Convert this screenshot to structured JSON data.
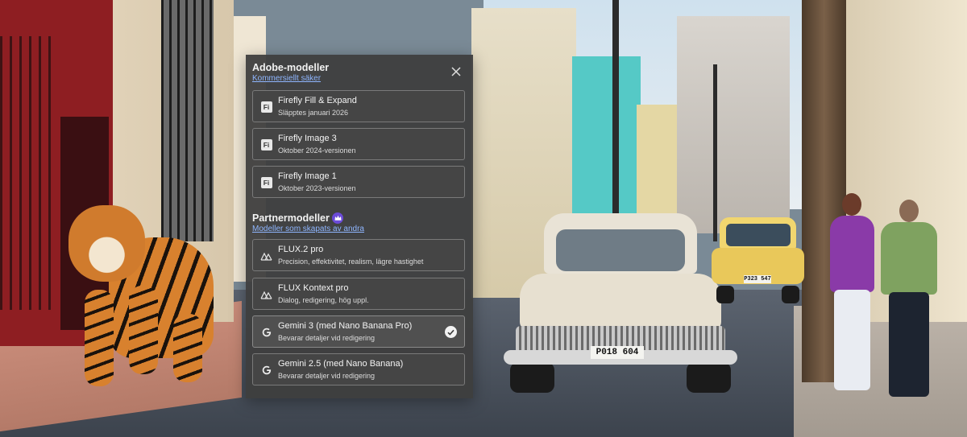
{
  "background": {
    "car1_plate": "P018 604",
    "car2_plate": "P323 547"
  },
  "panel": {
    "adobe_section": {
      "title": "Adobe-modeller",
      "subtitle": "Kommersiellt säker"
    },
    "partner_section": {
      "title": "Partnermodeller",
      "subtitle": "Modeller som skapats av andra"
    },
    "icon_fi_text": "Fi",
    "adobe_models": [
      {
        "name": "Firefly Fill & Expand",
        "desc": "Släpptes januari 2026",
        "icon": "firefly-icon"
      },
      {
        "name": "Firefly Image 3",
        "desc": "Oktober 2024-versionen",
        "icon": "firefly-icon"
      },
      {
        "name": "Firefly Image 1",
        "desc": "Oktober 2023-versionen",
        "icon": "firefly-icon"
      }
    ],
    "partner_models": [
      {
        "name": "FLUX.2 pro",
        "desc": "Precision, effektivitet, realism, lägre hastighet",
        "icon": "flux-icon"
      },
      {
        "name": "FLUX Kontext pro",
        "desc": "Dialog, redigering, hög uppl.",
        "icon": "flux-icon"
      },
      {
        "name": "Gemini 3 (med Nano Banana Pro)",
        "desc": "Bevarar detaljer vid redigering",
        "icon": "google-icon",
        "selected": true
      },
      {
        "name": "Gemini 2.5 (med Nano Banana)",
        "desc": "Bevarar detaljer vid redigering",
        "icon": "google-icon"
      }
    ]
  }
}
